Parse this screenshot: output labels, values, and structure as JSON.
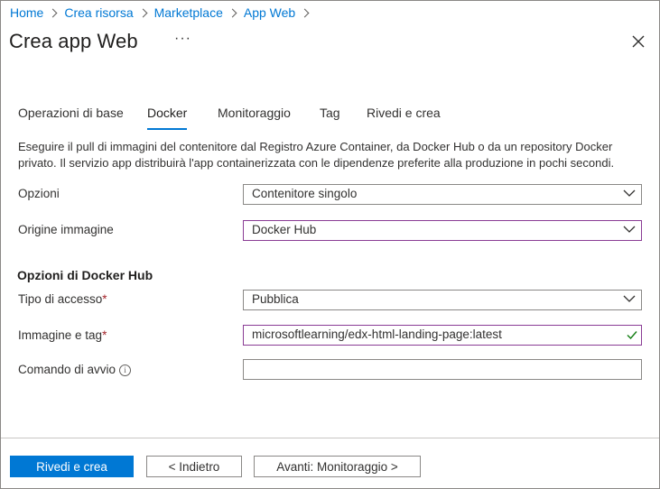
{
  "breadcrumb": [
    "Home",
    "Crea risorsa",
    "Marketplace",
    "App Web"
  ],
  "header": {
    "title": "Crea app Web",
    "more": "···"
  },
  "tabs": [
    {
      "label": "Operazioni di base",
      "active": false
    },
    {
      "label": "Docker",
      "active": true
    },
    {
      "label": "Monitoraggio",
      "active": false
    },
    {
      "label": "Tag",
      "active": false
    },
    {
      "label": "Rivedi e crea",
      "active": false
    }
  ],
  "description": "Eseguire il pull di immagini del contenitore dal Registro Azure Container, da Docker Hub o da un repository Docker privato. Il servizio app distribuirà l'app containerizzata con le dipendenze preferite alla produzione in pochi secondi.",
  "form": {
    "options_label": "Opzioni",
    "options_value": "Contenitore singolo",
    "image_source_label": "Origine immagine",
    "image_source_value": "Docker Hub",
    "section_title": "Opzioni di Docker Hub",
    "access_type_label": "Tipo di accesso",
    "access_type_value": "Pubblica",
    "image_tag_label": "Immagine e tag",
    "image_tag_value": "microsoftlearning/edx-html-landing-page:latest",
    "startup_command_label": "Comando di avvio",
    "startup_command_value": "",
    "required_marker": "*"
  },
  "footer": {
    "review_create": "Rivedi e crea",
    "back": "< Indietro",
    "next": "Avanti: Monitoraggio >"
  },
  "colors": {
    "accent": "#0078d4",
    "focus_border": "#8a3c95",
    "required": "#a4262c",
    "valid_check": "#107c10"
  }
}
